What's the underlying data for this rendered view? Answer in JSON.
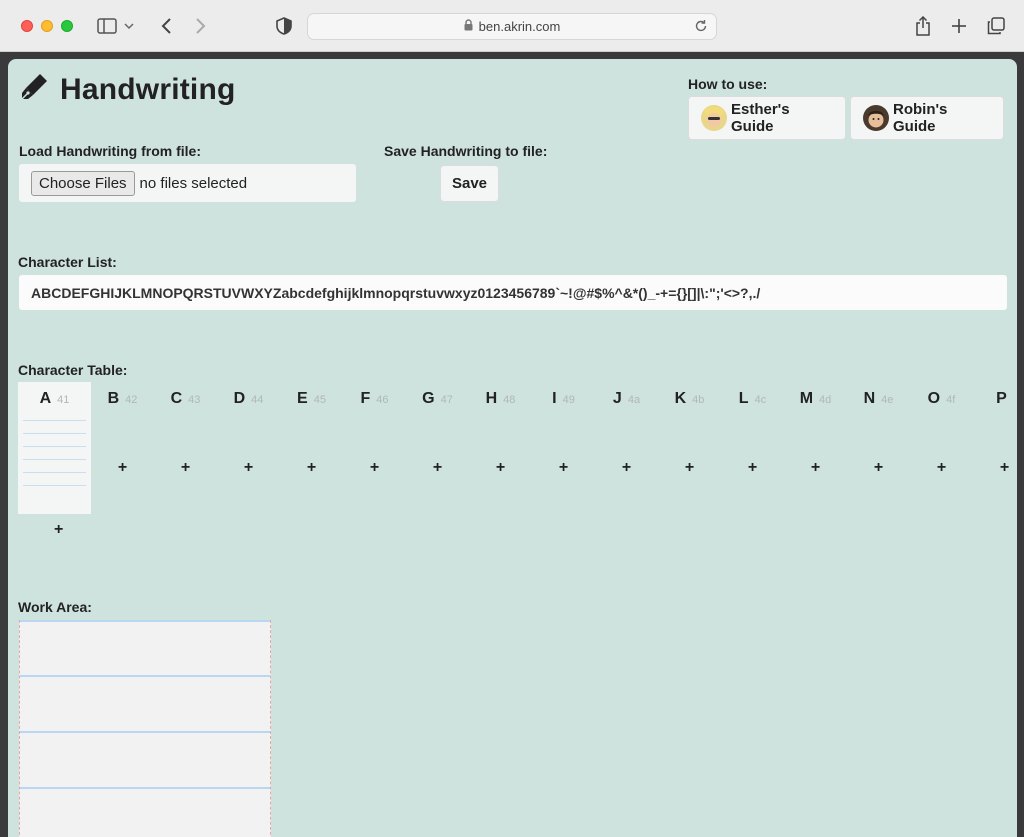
{
  "browser": {
    "url": "ben.akrin.com"
  },
  "page": {
    "title": "Handwriting",
    "how_to_use_label": "How to use:",
    "guides": [
      {
        "label": "Esther's Guide"
      },
      {
        "label": "Robin's Guide"
      }
    ],
    "load_label": "Load Handwriting from file:",
    "choose_files_label": "Choose Files",
    "no_file_text": "no files selected",
    "save_to_file_label": "Save Handwriting to file:",
    "save_button_label": "Save",
    "character_list_label": "Character List:",
    "character_list_value": "ABCDEFGHIJKLMNOPQRSTUVWXYZabcdefghijklmnopqrstuvwxyz0123456789`~!@#$%^&*()_-+={}[]|\\:\";'<>?,./",
    "character_table_label": "Character Table:",
    "characters": [
      {
        "ch": "A",
        "hex": "41"
      },
      {
        "ch": "B",
        "hex": "42"
      },
      {
        "ch": "C",
        "hex": "43"
      },
      {
        "ch": "D",
        "hex": "44"
      },
      {
        "ch": "E",
        "hex": "45"
      },
      {
        "ch": "F",
        "hex": "46"
      },
      {
        "ch": "G",
        "hex": "47"
      },
      {
        "ch": "H",
        "hex": "48"
      },
      {
        "ch": "I",
        "hex": "49"
      },
      {
        "ch": "J",
        "hex": "4a"
      },
      {
        "ch": "K",
        "hex": "4b"
      },
      {
        "ch": "L",
        "hex": "4c"
      },
      {
        "ch": "M",
        "hex": "4d"
      },
      {
        "ch": "N",
        "hex": "4e"
      },
      {
        "ch": "O",
        "hex": "4f"
      },
      {
        "ch": "P",
        "hex": ""
      }
    ],
    "plus_symbol": "+",
    "work_area_label": "Work Area:"
  },
  "colors": {
    "page_bg": "#cfe3de",
    "accent_line": "#b9d7f3",
    "margin_line": "#e7a7a7"
  },
  "icons": [
    "sidebar-icon",
    "back-icon",
    "forward-icon",
    "shield-icon",
    "lock-icon",
    "reload-icon",
    "share-icon",
    "new-tab-icon",
    "tabs-icon",
    "pen-icon"
  ]
}
